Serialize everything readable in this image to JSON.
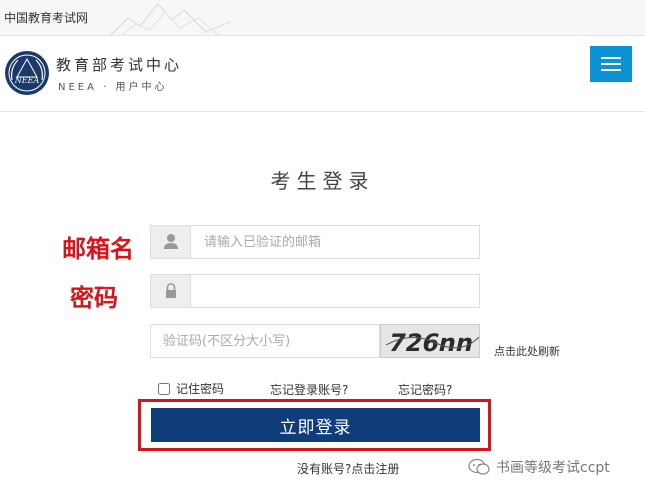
{
  "top_bar": {
    "site_link": "中国教育考试网"
  },
  "header": {
    "org_name": "教育部考试中心",
    "org_sub": "NEEA · 用户中心",
    "logo_text": "NEEA",
    "menu_icon": "hamburger-menu-icon",
    "accent": "#0b93d5"
  },
  "main": {
    "title": "考生登录",
    "annotations": {
      "email": "邮箱名",
      "password": "密码",
      "color": "#d6141b"
    },
    "email": {
      "icon": "user-icon",
      "placeholder": "请输入已验证的邮箱",
      "value": ""
    },
    "password": {
      "icon": "lock-icon",
      "value": ""
    },
    "captcha": {
      "placeholder": "验证码(不区分大小写)",
      "image_text": "726nn",
      "refresh": "点击此处刷新"
    },
    "remember": {
      "label": "记住密码",
      "checked": false
    },
    "forgot_account": "忘记登录账号?",
    "forgot_password": "忘记密码?",
    "login_button": "立即登录",
    "login_color": "#0e3d7a",
    "register": "没有账号?点击注册"
  },
  "watermark": {
    "text": "书画等级考试ccpt",
    "icon": "wechat-icon"
  }
}
